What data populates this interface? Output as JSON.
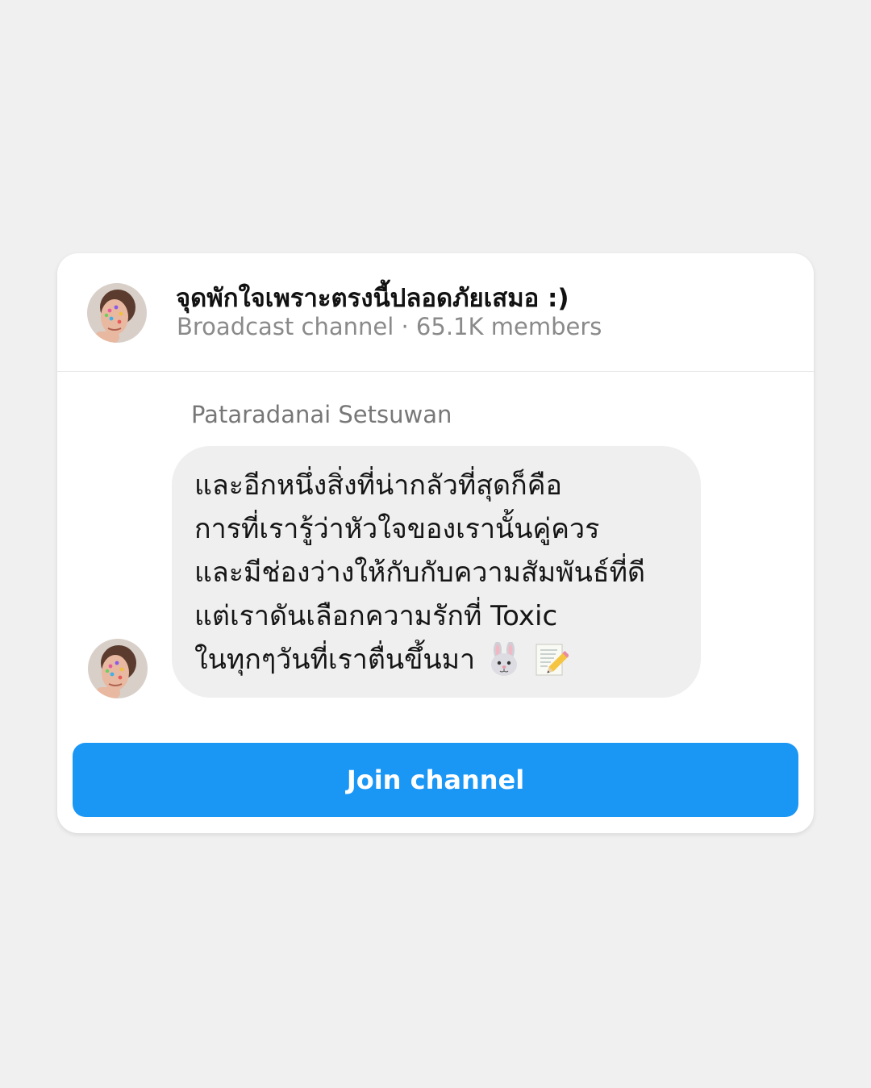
{
  "channel": {
    "title": "จุดพักใจเพราะตรงนี้ปลอดภัยเสมอ :)",
    "subtitle": "Broadcast channel · 65.1K members",
    "avatar_icon": "profile-photo-avatar"
  },
  "message": {
    "sender": "Pataradanai Setsuwan",
    "lines": [
      "และอีกหนึ่งสิ่งที่น่ากลัวที่สุดก็คือ",
      "การที่เรารู้ว่าหัวใจของเรานั้นคู่ควร",
      "และมีช่องว่างให้กับกับความสัมพันธ์ที่ดี",
      "แต่เราดันเลือกความรักที่ Toxic",
      "ในทุกๆวันที่เราตื่นขึ้นมา"
    ],
    "emojis": [
      "rabbit-face-icon",
      "memo-icon"
    ],
    "bubble_color": "#efefef"
  },
  "join_button": {
    "label": "Join channel",
    "color": "#1a96f5"
  }
}
